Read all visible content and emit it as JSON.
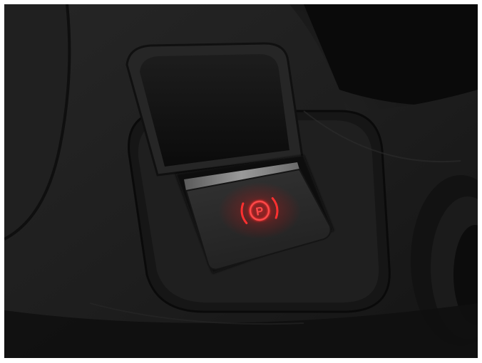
{
  "scene": {
    "subject": "electronic-parking-brake-switch",
    "indicator_symbol": "P",
    "indicator_color": "#ff2a2a",
    "indicator_glow_color": "#ff1a1a",
    "console_color": "#1c1c1c",
    "switch_face_color": "#2b2b2b",
    "switch_lip_color": "#8c8c8c",
    "background_color": "#121212"
  }
}
